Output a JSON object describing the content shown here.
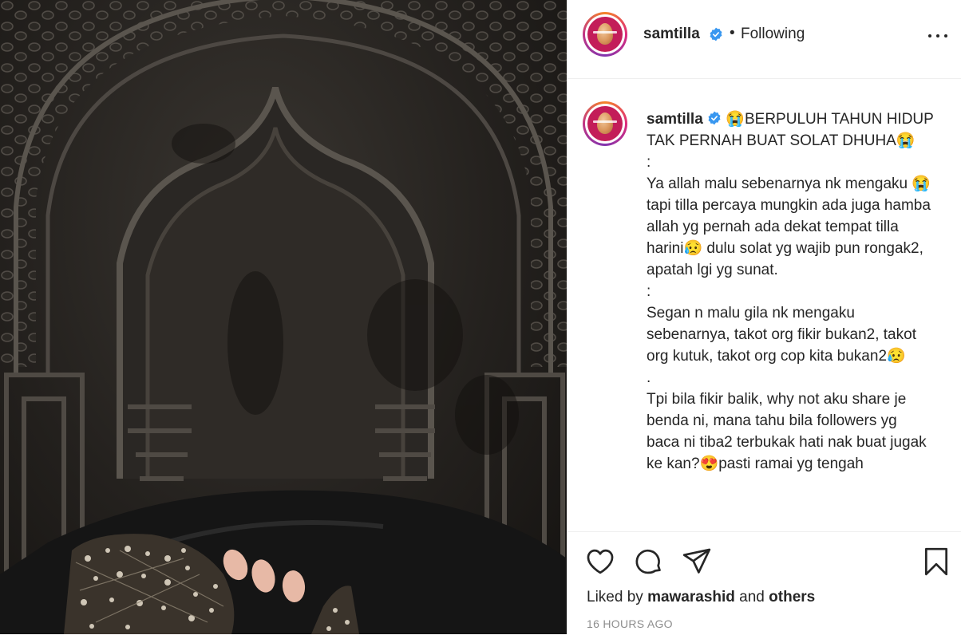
{
  "post": {
    "username": "samtilla",
    "follow_status": "Following",
    "separator": "•"
  },
  "caption": {
    "username": "samtilla",
    "text": "😭BERPULUH TAHUN HIDUP TAK PERNAH BUAT SOLAT DHUHA😭\n:\nYa allah malu sebenarnya nk mengaku 😭tapi tilla percaya mungkin ada juga hamba allah yg pernah ada dekat tempat tilla harini😥 dulu solat yg wajib pun rongak2, apatah lgi yg sunat.\n:\nSegan n malu gila nk mengaku sebenarnya, takot org fikir bukan2, takot org kutuk, takot org cop kita bukan2😥\n.\nTpi bila fikir balik, why not aku share je benda ni, mana tahu bila followers yg baca ni tiba2 terbukak hati nak buat jugak ke kan?😍pasti ramai yg tengah"
  },
  "actions": {
    "like_icon": "heart-icon",
    "comment_icon": "comment-icon",
    "share_icon": "paper-plane-icon",
    "save_icon": "bookmark-icon"
  },
  "likes": {
    "prefix": "Liked by",
    "user": "mawarashid",
    "conjunction": "and",
    "others": "others"
  },
  "timestamp": "16 HOURS AGO",
  "colors": {
    "verified": "#3897f0",
    "text": "#262626",
    "muted": "#8e8e8e",
    "avatar_bg": "#c31d59"
  }
}
